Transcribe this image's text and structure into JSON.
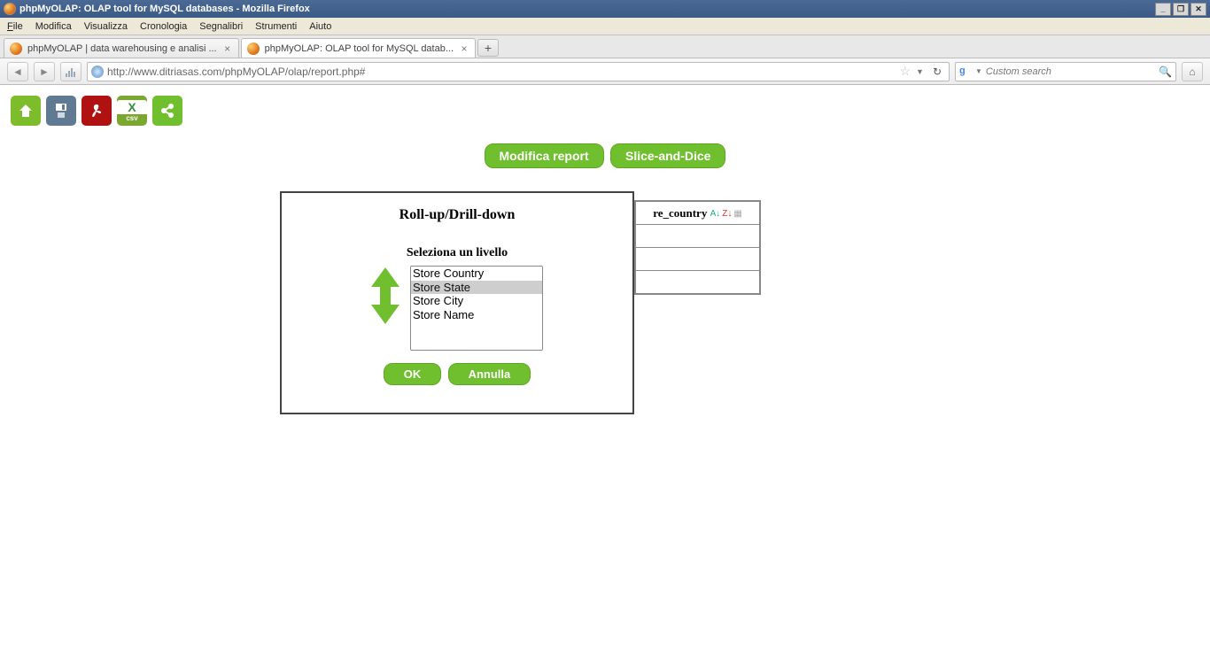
{
  "window": {
    "title": "phpMyOLAP: OLAP tool for MySQL databases - Mozilla Firefox"
  },
  "menu": {
    "file": "File",
    "modifica": "Modifica",
    "visualizza": "Visualizza",
    "cronologia": "Cronologia",
    "segnalibri": "Segnalibri",
    "strumenti": "Strumenti",
    "aiuto": "Aiuto"
  },
  "tabs": [
    {
      "label": "phpMyOLAP | data warehousing e analisi ..."
    },
    {
      "label": "phpMyOLAP: OLAP tool for MySQL datab..."
    }
  ],
  "url": "http://www.ditriasas.com/phpMyOLAP/olap/report.php#",
  "search": {
    "placeholder": "Custom search"
  },
  "actions": {
    "modifica_report": "Modifica report",
    "slice_and_dice": "Slice-and-Dice"
  },
  "dialog": {
    "title": "Roll-up/Drill-down",
    "subtitle": "Seleziona un livello",
    "levels": [
      "Store Country",
      "Store State",
      "Store City",
      "Store Name"
    ],
    "selected_index": 1,
    "ok": "OK",
    "annulla": "Annulla"
  },
  "report": {
    "header_fragment": "re_country"
  },
  "toolbar": {
    "pdf_label": "",
    "csv_x": "X",
    "csv_label": "csv"
  }
}
